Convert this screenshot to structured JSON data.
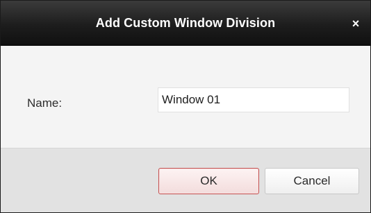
{
  "dialog": {
    "title": "Add Custom Window Division",
    "close_glyph": "×"
  },
  "form": {
    "name_label": "Name:",
    "name_value": "Window 01"
  },
  "buttons": {
    "ok_label": "OK",
    "cancel_label": "Cancel"
  },
  "colors": {
    "titlebar": "#1d1d1d",
    "ok_border_accent": "#c44f4f"
  },
  "icons": {
    "close": "close-icon"
  }
}
